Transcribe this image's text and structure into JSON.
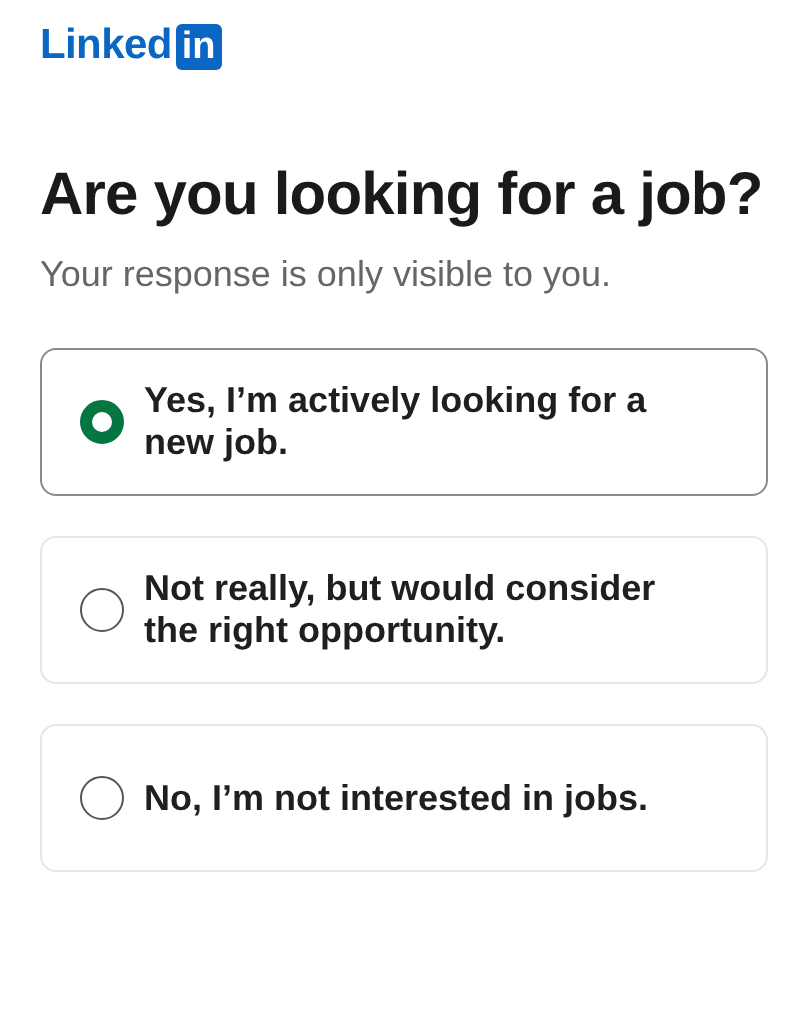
{
  "logo": {
    "word": "Linked",
    "badge": "in"
  },
  "title": "Are you looking for a job?",
  "subtitle": "Your response is only visible to you.",
  "options": [
    {
      "label": "Yes, I’m actively looking for a new job.",
      "selected": true
    },
    {
      "label": "Not really, but would consider the right opportunity.",
      "selected": false
    },
    {
      "label": "No, I’m not interested in jobs.",
      "selected": false
    }
  ]
}
